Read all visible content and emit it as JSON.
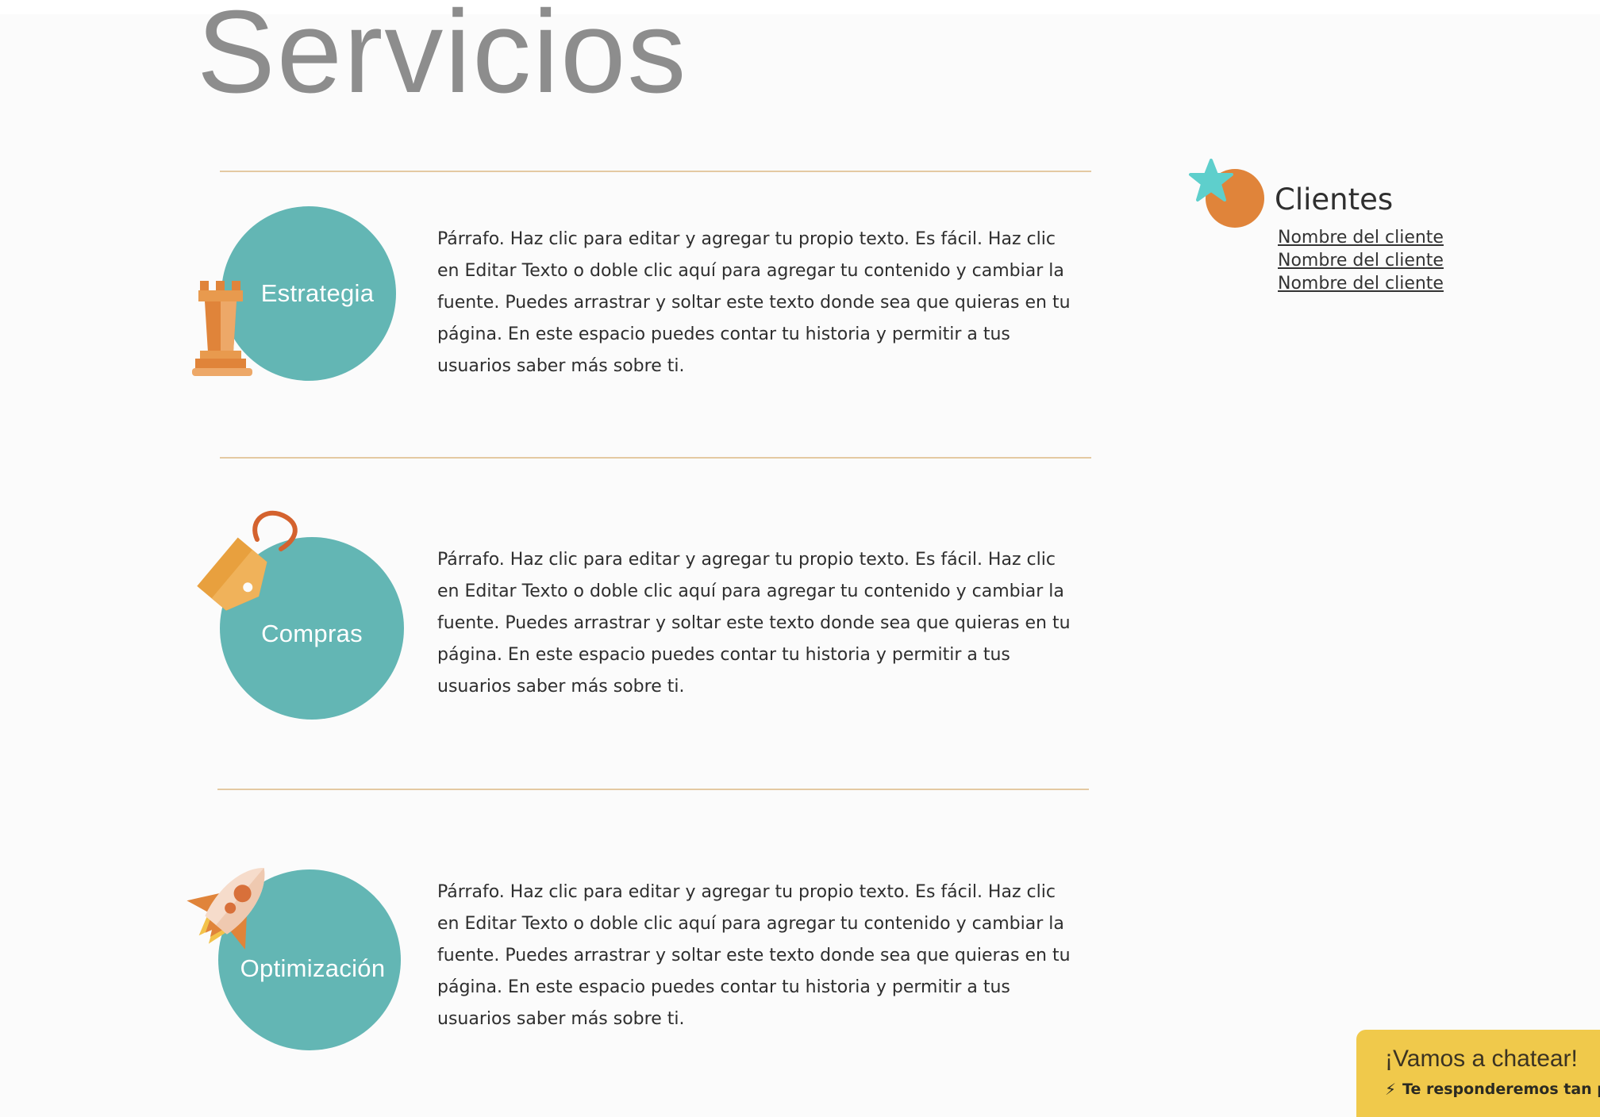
{
  "colors": {
    "background": "#fbfbfb",
    "circle": "#63b6b4",
    "divider": "#e4c9a2",
    "title": "#8d8d8d",
    "orange": "#e0843a",
    "chat": "#f0c94b"
  },
  "page": {
    "title": "Servicios"
  },
  "services": [
    {
      "label": "Estrategia",
      "icon": "chess-rook-icon",
      "text": "Párrafo. Haz clic para editar y agregar tu propio texto. Es fácil. Haz clic en Editar Texto o doble clic aquí para agregar tu contenido y cambiar la fuente. Puedes arrastrar y soltar este texto donde sea que quieras en tu página. En este espacio puedes contar tu historia y permitir a tus usuarios saber más sobre ti."
    },
    {
      "label": "Compras",
      "icon": "price-tag-icon",
      "text": "Párrafo. Haz clic para editar y agregar tu propio texto. Es fácil. Haz clic en Editar Texto o doble clic aquí para agregar tu contenido y cambiar la fuente. Puedes arrastrar y soltar este texto donde sea que quieras en tu página. En este espacio puedes contar tu historia y permitir a tus usuarios saber más sobre ti."
    },
    {
      "label": "Optimización",
      "icon": "rocket-icon",
      "text": "Párrafo. Haz clic para editar y agregar tu propio texto. Es fácil. Haz clic en Editar Texto o doble clic aquí para agregar tu contenido y cambiar la fuente. Puedes arrastrar y soltar este texto donde sea que quieras en tu página. En este espacio puedes contar tu historia y permitir a tus usuarios saber más sobre ti."
    }
  ],
  "clients": {
    "icon": "star-badge-icon",
    "title": "Clientes",
    "items": [
      "Nombre del cliente",
      "Nombre del cliente",
      "Nombre del cliente"
    ]
  },
  "chat": {
    "title": "¡Vamos a chatear!",
    "subtitle": "Te responderemos tan p",
    "icon": "lightning-icon"
  }
}
